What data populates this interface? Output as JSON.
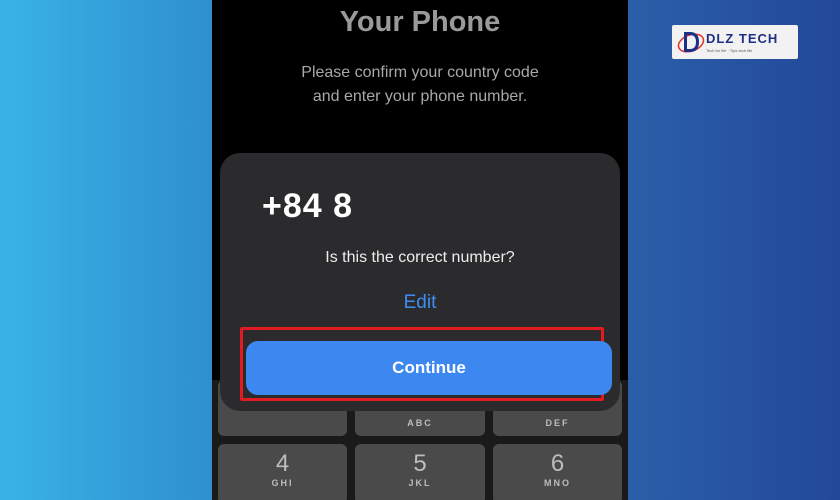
{
  "screen": {
    "title": "Your Phone",
    "subtitle_line1": "Please confirm your country code",
    "subtitle_line2": "and enter your phone number."
  },
  "dialog": {
    "phone_number": "+84 8",
    "question": "Is this the correct number?",
    "edit_label": "Edit",
    "continue_label": "Continue"
  },
  "keypad": {
    "keys": [
      {
        "num": "",
        "letters": ""
      },
      {
        "num": "",
        "letters": "ABC"
      },
      {
        "num": "",
        "letters": "DEF"
      },
      {
        "num": "4",
        "letters": "GHI"
      },
      {
        "num": "5",
        "letters": "JKL"
      },
      {
        "num": "6",
        "letters": "MNO"
      }
    ]
  },
  "logo": {
    "brand": "DLZ TECH",
    "tagline": "Tech for life · Tips tech life"
  },
  "colors": {
    "accent": "#3d88f0",
    "highlight": "#e21b22",
    "sheet": "#2b2b2d"
  }
}
